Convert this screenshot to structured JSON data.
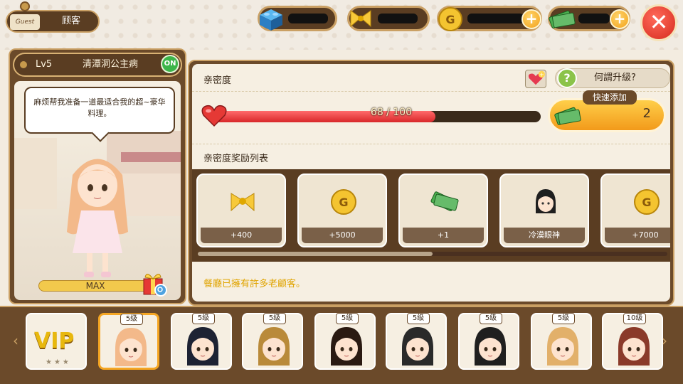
{
  "header": {
    "guest_tag": "Guest",
    "guest_label": "顾客",
    "currencies": [
      {
        "name": "blocks",
        "icon": "blue-block-icon",
        "value": "",
        "has_plus": false
      },
      {
        "name": "pasta",
        "icon": "bow-pasta-icon",
        "value": "",
        "has_plus": false
      },
      {
        "name": "gold",
        "icon": "gold-coin-icon",
        "value": "",
        "has_plus": true
      },
      {
        "name": "cash",
        "icon": "cash-icon",
        "value": "",
        "has_plus": true
      }
    ],
    "close_icon": "close-icon"
  },
  "character": {
    "level": "Lv5",
    "name": "清潭洞公主病",
    "status": "ON",
    "speech": "麻烦帮我准备一道最适合我的超~豪华料理。",
    "bar_label": "MAX"
  },
  "intimacy": {
    "title": "亲密度",
    "levelup_label": "何謂升級?",
    "current": 68,
    "max": 100,
    "progress_text": "68 / 100",
    "quick_add_label": "快速添加",
    "quick_add_value": "2"
  },
  "rewards": {
    "title": "亲密度奖励列表",
    "items": [
      {
        "icon": "bow-pasta-icon",
        "label": "+400"
      },
      {
        "icon": "gold-coin-icon",
        "label": "+5000"
      },
      {
        "icon": "cash-icon",
        "label": "+1"
      },
      {
        "icon": "girl-avatar-icon",
        "label": "冷漠眼神"
      },
      {
        "icon": "gold-coin-icon",
        "label": "+7000"
      }
    ],
    "scroll_fraction": 0.5
  },
  "notice": "餐廳已擁有許多老顧客。",
  "customers": {
    "vip_label": "VIP",
    "vip_stars": "★★★",
    "slots": [
      {
        "badge": "5级",
        "selected": true,
        "hair": "#f3b98a"
      },
      {
        "badge": "5级",
        "selected": false,
        "hair": "#1d2233"
      },
      {
        "badge": "5级",
        "selected": false,
        "hair": "#b98a3a"
      },
      {
        "badge": "5级",
        "selected": false,
        "hair": "#2a1a12"
      },
      {
        "badge": "5级",
        "selected": false,
        "hair": "#2a2a2a"
      },
      {
        "badge": "5级",
        "selected": false,
        "hair": "#1f1f1f"
      },
      {
        "badge": "5级",
        "selected": false,
        "hair": "#e2b06a"
      },
      {
        "badge": "10级",
        "selected": false,
        "hair": "#8a3a2a"
      }
    ]
  },
  "colors": {
    "panel_brown": "#6b4a2a",
    "panel_light": "#f6efe2",
    "accent_orange": "#f29a1a",
    "heart_red": "#d8282a",
    "notice_yellow": "#e0a400"
  }
}
